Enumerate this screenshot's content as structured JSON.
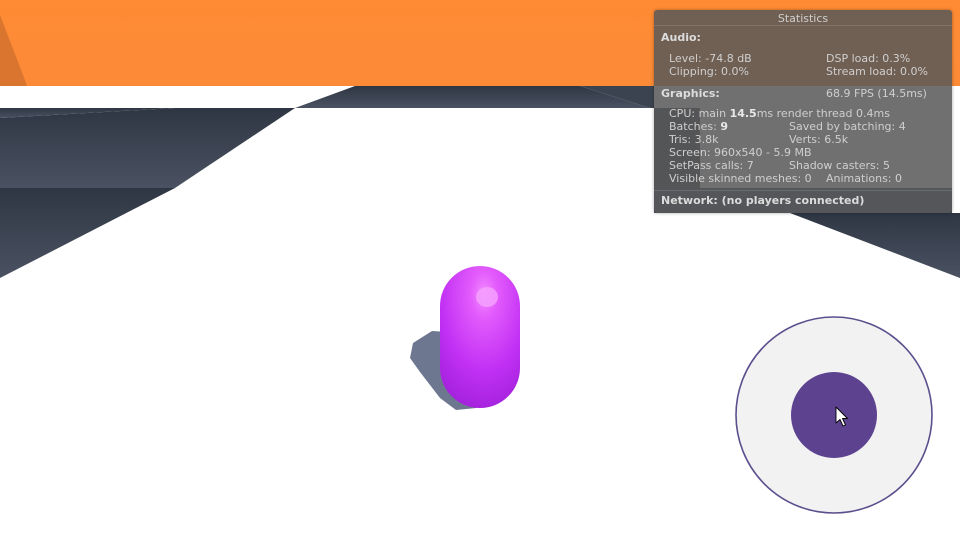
{
  "stats": {
    "title": "Statistics",
    "audio": {
      "header": "Audio:",
      "level": "Level: -74.8 dB",
      "dsp_load": "DSP load: 0.3%",
      "clipping": "Clipping: 0.0%",
      "stream_load": "Stream load: 0.0%"
    },
    "graphics": {
      "header": "Graphics:",
      "fps": "68.9 FPS (14.5ms)",
      "cpu_prefix": "CPU: main ",
      "cpu_main": "14.5",
      "cpu_suffix": "ms  render thread 0.4ms",
      "batches_prefix": "Batches: ",
      "batches": "9",
      "saved_by_batching": "Saved by batching: 4",
      "tris": "Tris: 3.8k",
      "verts": "Verts: 6.5k",
      "screen": "Screen: 960x540 - 5.9 MB",
      "setpass_calls": "SetPass calls: 7",
      "shadow_casters": "Shadow casters: 5",
      "visible_skinned_meshes": "Visible skinned meshes: 0",
      "animations": "Animations: 0"
    },
    "network": "Network: (no players connected)"
  },
  "colors": {
    "sky": "#FF8A33",
    "floor_light": "#FFFFFF",
    "floor_dark": "#3D4452",
    "player": "#C432F5",
    "joystick_base": "#F2F2F2",
    "joystick_knob": "#5D4290"
  },
  "icons": {
    "cursor": "mouse-pointer-icon"
  }
}
